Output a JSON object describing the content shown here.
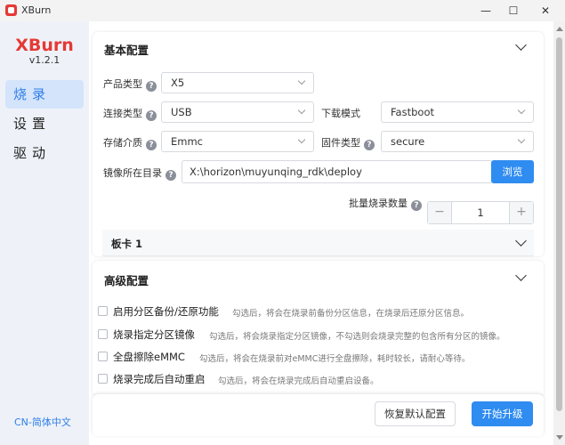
{
  "window": {
    "title": "XBurn",
    "minimize": "—",
    "maximize": "☐",
    "close": "✕"
  },
  "sidebar": {
    "logo": "XBurn",
    "version": "v1.2.1",
    "items": [
      {
        "label": "烧录",
        "active": true
      },
      {
        "label": "设置",
        "active": false
      },
      {
        "label": "驱动",
        "active": false
      }
    ],
    "language": "CN-简体中文"
  },
  "basic": {
    "title": "基本配置",
    "product_type": {
      "label": "产品类型",
      "value": "X5"
    },
    "connect_type": {
      "label": "连接类型",
      "value": "USB"
    },
    "download_mode": {
      "label": "下载模式",
      "value": "Fastboot"
    },
    "storage": {
      "label": "存储介质",
      "value": "Emmc"
    },
    "firmware_type": {
      "label": "固件类型",
      "value": "secure"
    },
    "image_dir": {
      "label": "镜像所在目录",
      "value": "X:\\horizon\\muyunqing_rdk\\deploy",
      "browse": "浏览"
    },
    "batch": {
      "label": "批量烧录数量",
      "value": "1",
      "minus": "−",
      "plus": "+"
    },
    "board": {
      "title": "板卡 1"
    },
    "help_glyph": "?"
  },
  "advanced": {
    "title": "高级配置",
    "options": [
      {
        "label": "启用分区备份/还原功能",
        "desc": "勾选后，将会在烧录前备份分区信息，在烧录后还原分区信息。",
        "checked": false
      },
      {
        "label": "烧录指定分区镜像",
        "desc": "勾选后，将会烧录指定分区镜像，不勾选则会烧录完整的包含所有分区的镜像。",
        "checked": false
      },
      {
        "label": "全盘擦除eMMC",
        "desc": "勾选后，将会在烧录前对eMMC进行全盘擦除，耗时较长，请耐心等待。",
        "checked": false
      },
      {
        "label": "烧录完成后自动重启",
        "desc": "勾选后，将会在烧录完成后自动重启设备。",
        "checked": false
      }
    ]
  },
  "footer": {
    "reset": "恢复默认配置",
    "start": "开始升级"
  },
  "colors": {
    "brand": "#e53935",
    "accent": "#2f8cf0",
    "nav_active_bg": "#d4e4fb"
  }
}
